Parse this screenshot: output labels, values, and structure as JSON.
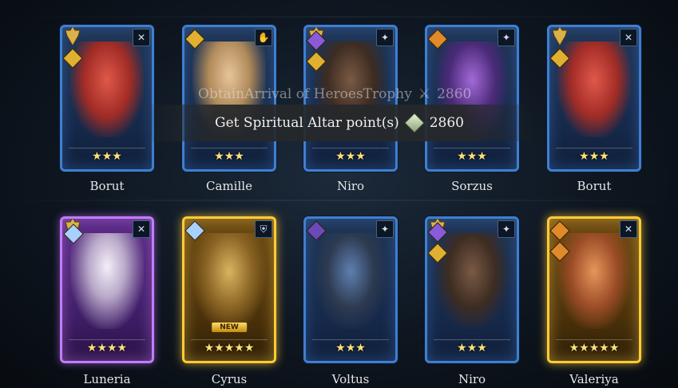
{
  "notification": {
    "ghost_text": "ObtainArrival of HeroesTrophy",
    "ghost_value": "2860",
    "text": "Get Spiritual Altar point(s)",
    "value": "2860",
    "icon": "altar-crystal-icon"
  },
  "rows": [
    [
      {
        "name": "Borut",
        "rarity": "rare",
        "stars": "★★★",
        "class_icon": "✕",
        "affinity": [
          "spirit"
        ]
      },
      {
        "name": "Camille",
        "rarity": "rare",
        "stars": "★★★",
        "class_icon": "✋",
        "affinity": [
          "spirit"
        ]
      },
      {
        "name": "Niro",
        "rarity": "rare",
        "stars": "★★★",
        "class_icon": "✦",
        "affinity": [
          "magic",
          "spirit"
        ]
      },
      {
        "name": "Sorzus",
        "rarity": "rare",
        "stars": "★★★",
        "class_icon": "✦",
        "affinity": [
          "force"
        ]
      },
      {
        "name": "Borut",
        "rarity": "rare",
        "stars": "★★★",
        "class_icon": "✕",
        "affinity": [
          "spirit"
        ]
      }
    ],
    [
      {
        "name": "Luneria",
        "rarity": "epic",
        "stars": "★★★★",
        "class_icon": "✕",
        "affinity": [
          "crystal"
        ]
      },
      {
        "name": "Cyrus",
        "rarity": "legend",
        "stars": "★★★★★",
        "class_icon": "⛨",
        "affinity": [
          "crystal"
        ],
        "badge": "NEW"
      },
      {
        "name": "Voltus",
        "rarity": "rare",
        "stars": "★★★",
        "class_icon": "✦",
        "affinity": [
          "void"
        ]
      },
      {
        "name": "Niro",
        "rarity": "rare",
        "stars": "★★★",
        "class_icon": "✦",
        "affinity": [
          "magic",
          "spirit"
        ]
      },
      {
        "name": "Valeriya",
        "rarity": "legend",
        "stars": "★★★★★",
        "class_icon": "✕",
        "affinity": [
          "force",
          "force"
        ]
      }
    ]
  ],
  "colors": {
    "rare": "#3f7fd0",
    "epic": "#c27cff",
    "legend": "#ffcc33",
    "star": "#ffe07a"
  }
}
